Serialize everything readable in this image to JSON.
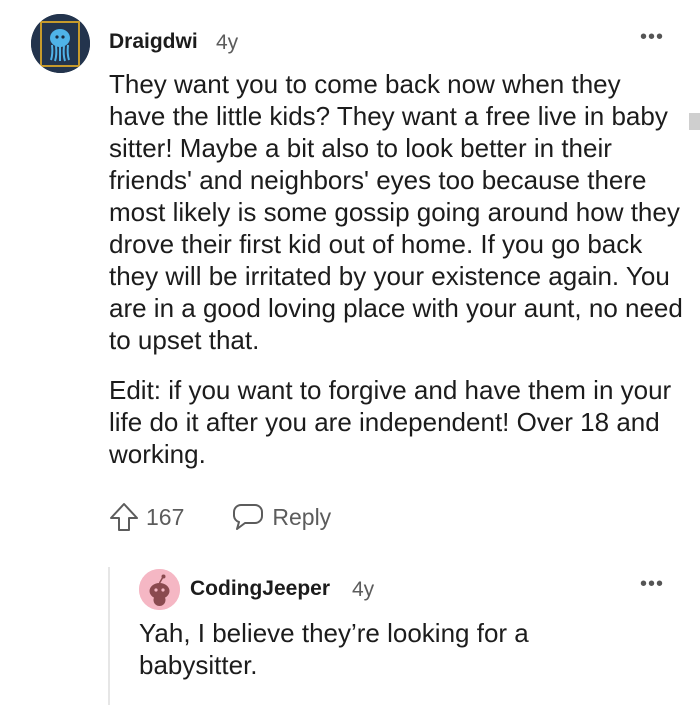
{
  "comment": {
    "username": "Draigdwi",
    "age": "4y",
    "paragraphs": [
      "They want you to come back now when they have the little kids? They want a free live in baby sitter! Maybe a bit also to look better in their friends' and neighbors' eyes too because there most likely is some gossip going around how they drove their first kid out of home. If you go back they will be irritated by your existence again. You are in a good loving place with your aunt, no need to upset that.",
      "Edit: if you want to forgive and have them in your life do it after you are independent! Over 18 and working."
    ],
    "vote_count": "167",
    "reply_label": "Reply",
    "more_label": "•••"
  },
  "reply": {
    "username": "CodingJeeper",
    "age": "4y",
    "text": "Yah, I believe they’re looking for a babysitter.",
    "more_label": "•••"
  },
  "icons": {
    "upvote": "arrow-up-outline-icon",
    "reply": "speech-bubble-icon",
    "more": "more-horizontal-icon"
  },
  "colors": {
    "text": "#1c1c1c",
    "meta": "#5c5c5c",
    "avatar_main_bg": "#23344d",
    "avatar_reply_bg": "#f5b7c4",
    "thread_line": "#e6e6e6"
  }
}
